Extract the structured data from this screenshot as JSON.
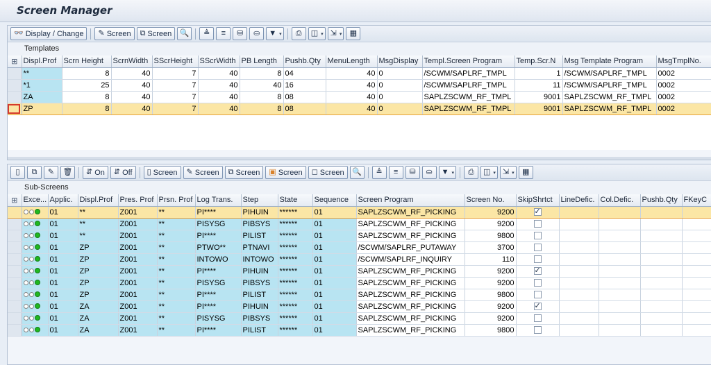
{
  "title": "Screen Manager",
  "templates_toolbar": {
    "display_change": "Display / Change",
    "screen": "Screen",
    "screen2": "Screen"
  },
  "templates_title": "Templates",
  "templates_columns": [
    "Displ.Prof",
    "Scrn Height",
    "ScrnWidth",
    "SScrHeight",
    "SScrWidth",
    "PB Length",
    "Pushb.Qty",
    "MenuLength",
    "MsgDisplay",
    "Templ.Screen Program",
    "Temp.Scr.N",
    "Msg Template Program",
    "MsgTmplNo."
  ],
  "templates_rows": [
    [
      "**",
      "8",
      "40",
      "7",
      "40",
      "8",
      "04",
      "40",
      "0",
      "/SCWM/SAPLRF_TMPL",
      "1",
      "/SCWM/SAPLRF_TMPL",
      "0002"
    ],
    [
      "*1",
      "25",
      "40",
      "7",
      "40",
      "40",
      "16",
      "40",
      "0",
      "/SCWM/SAPLRF_TMPL",
      "11",
      "/SCWM/SAPLRF_TMPL",
      "0002"
    ],
    [
      "ZA",
      "8",
      "40",
      "7",
      "40",
      "8",
      "08",
      "40",
      "0",
      "SAPLZSCWM_RF_TMPL",
      "9001",
      "SAPLZSCWM_RF_TMPL",
      "0002"
    ],
    [
      "ZP",
      "8",
      "40",
      "7",
      "40",
      "8",
      "08",
      "40",
      "0",
      "SAPLZSCWM_RF_TMPL",
      "9001",
      "SAPLZSCWM_RF_TMPL",
      "0002"
    ]
  ],
  "subs_toolbar": {
    "on": "On",
    "off": "Off",
    "screen_create": "Screen",
    "screen_change": "Screen",
    "screen_copy": "Screen",
    "screen_move": "Screen",
    "screen_delete": "Screen"
  },
  "subs_title": "Sub-Screens",
  "subs_columns": [
    "Exce...",
    "Applic.",
    "Displ.Prof",
    "Pres. Prof",
    "Prsn. Prof",
    "Log Trans.",
    "Step",
    "State",
    "Sequence",
    "Screen Program",
    "Screen No.",
    "SkipShrtct",
    "LineDefic.",
    "Col.Defic.",
    "Pushb.Qty",
    "FKeyC"
  ],
  "subs_rows": [
    [
      "01",
      "**",
      "Z001",
      "**",
      "PI****",
      "PIHUIN",
      "******",
      "01",
      "SAPLZSCWM_RF_PICKING",
      "9200",
      "on"
    ],
    [
      "01",
      "**",
      "Z001",
      "**",
      "PISYSG",
      "PIBSYS",
      "******",
      "01",
      "SAPLZSCWM_RF_PICKING",
      "9200",
      "off"
    ],
    [
      "01",
      "**",
      "Z001",
      "**",
      "PI****",
      "PILIST",
      "******",
      "01",
      "SAPLZSCWM_RF_PICKING",
      "9800",
      "off"
    ],
    [
      "01",
      "ZP",
      "Z001",
      "**",
      "PTWO**",
      "PTNAVI",
      "******",
      "01",
      "/SCWM/SAPLRF_PUTAWAY",
      "3700",
      "off"
    ],
    [
      "01",
      "ZP",
      "Z001",
      "**",
      "INTOWO",
      "INTOWO",
      "******",
      "01",
      "/SCWM/SAPLRF_INQUIRY",
      "110",
      "off"
    ],
    [
      "01",
      "ZP",
      "Z001",
      "**",
      "PI****",
      "PIHUIN",
      "******",
      "01",
      "SAPLZSCWM_RF_PICKING",
      "9200",
      "on"
    ],
    [
      "01",
      "ZP",
      "Z001",
      "**",
      "PISYSG",
      "PIBSYS",
      "******",
      "01",
      "SAPLZSCWM_RF_PICKING",
      "9200",
      "off"
    ],
    [
      "01",
      "ZP",
      "Z001",
      "**",
      "PI****",
      "PILIST",
      "******",
      "01",
      "SAPLZSCWM_RF_PICKING",
      "9800",
      "off"
    ],
    [
      "01",
      "ZA",
      "Z001",
      "**",
      "PI****",
      "PIHUIN",
      "******",
      "01",
      "SAPLZSCWM_RF_PICKING",
      "9200",
      "on"
    ],
    [
      "01",
      "ZA",
      "Z001",
      "**",
      "PISYSG",
      "PIBSYS",
      "******",
      "01",
      "SAPLZSCWM_RF_PICKING",
      "9200",
      "off"
    ],
    [
      "01",
      "ZA",
      "Z001",
      "**",
      "PI****",
      "PILIST",
      "******",
      "01",
      "SAPLZSCWM_RF_PICKING",
      "9800",
      "off"
    ]
  ],
  "colors": {
    "key_cell": "#b8e4f2",
    "active_row": "#fbe6a5",
    "status_green": "#1fb81f"
  }
}
